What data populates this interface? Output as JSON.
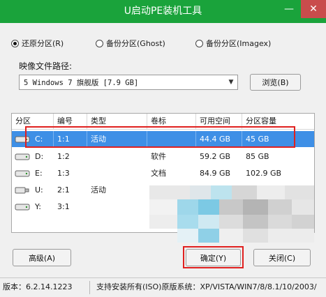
{
  "window": {
    "title": "U启动PE装机工具",
    "minimize_glyph": "—",
    "close_glyph": "✕",
    "title_bar_color": "#1aa33b"
  },
  "modes": [
    {
      "label": "还原分区(R)",
      "selected": true
    },
    {
      "label": "备份分区(Ghost)",
      "selected": false
    },
    {
      "label": "备份分区(Imagex)",
      "selected": false
    }
  ],
  "image_path": {
    "label": "映像文件路径:",
    "value": "5 Windows 7 旗舰版 [7.9 GB]",
    "browse_label": "浏览(B)"
  },
  "partition_table": {
    "columns": [
      "分区",
      "编号",
      "类型",
      "卷标",
      "可用空间",
      "分区容量"
    ],
    "rows": [
      {
        "drive": "C:",
        "number": "1:1",
        "type": "活动",
        "label": "",
        "free": "44.4 GB",
        "capacity": "45 GB",
        "selected": true
      },
      {
        "drive": "D:",
        "number": "1:2",
        "type": "",
        "label": "软件",
        "free": "59.2 GB",
        "capacity": "85 GB",
        "selected": false
      },
      {
        "drive": "E:",
        "number": "1:3",
        "type": "",
        "label": "文档",
        "free": "84.9 GB",
        "capacity": "102.9 GB",
        "selected": false
      },
      {
        "drive": "U:",
        "number": "2:1",
        "type": "活动",
        "label": "",
        "free": "",
        "capacity": "",
        "selected": false
      },
      {
        "drive": "Y:",
        "number": "3:1",
        "type": "",
        "label": "",
        "free": "",
        "capacity": "",
        "selected": false
      }
    ],
    "selection_color": "#3e8fe6"
  },
  "buttons": {
    "advanced": "高级(A)",
    "confirm": "确定(Y)",
    "close": "关闭(C)"
  },
  "status": {
    "version": "版本：6.2.14.1223",
    "support": "支持安装所有(ISO)原版系统：XP/VISTA/WIN7/8/8.1/10/2003/"
  },
  "highlight_color": "#e0201f"
}
